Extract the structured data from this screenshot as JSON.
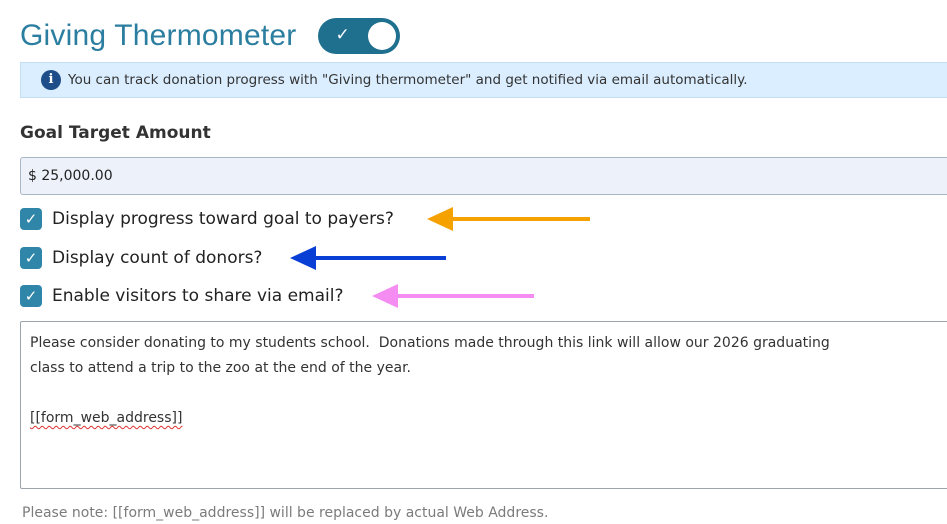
{
  "header": {
    "title": "Giving Thermometer",
    "toggle": {
      "state": "on",
      "check_glyph": "✓",
      "color": "#1f6f8f"
    }
  },
  "info": {
    "icon": "info-icon",
    "icon_glyph": "i",
    "text": "You can track donation progress with \"Giving thermometer\" and get notified via email automatically."
  },
  "goal": {
    "label": "Goal Target Amount",
    "value": "$ 25,000.00"
  },
  "options": [
    {
      "label": "Display progress toward goal to payers?",
      "checked": true
    },
    {
      "label": "Display count of donors?",
      "checked": true
    },
    {
      "label": "Enable visitors to share via email?",
      "checked": true
    }
  ],
  "checkbox_glyph": "✓",
  "annotation_arrows": [
    {
      "color": "#f5a100",
      "points_to": "Display progress toward goal to payers?"
    },
    {
      "color": "#0a3fd6",
      "points_to": "Display count of donors?"
    },
    {
      "color": "#f48cf2",
      "points_to": "Enable visitors to share via email?"
    }
  ],
  "message": {
    "line1": "Please consider donating to my students school.  Donations made through this link will allow our 2026 graduating",
    "line2": "class to attend a trip to the zoo at the end of the year.",
    "token": "[[form_web_address]]"
  },
  "note": "Please note: [[form_web_address]] will be replaced by actual Web Address."
}
